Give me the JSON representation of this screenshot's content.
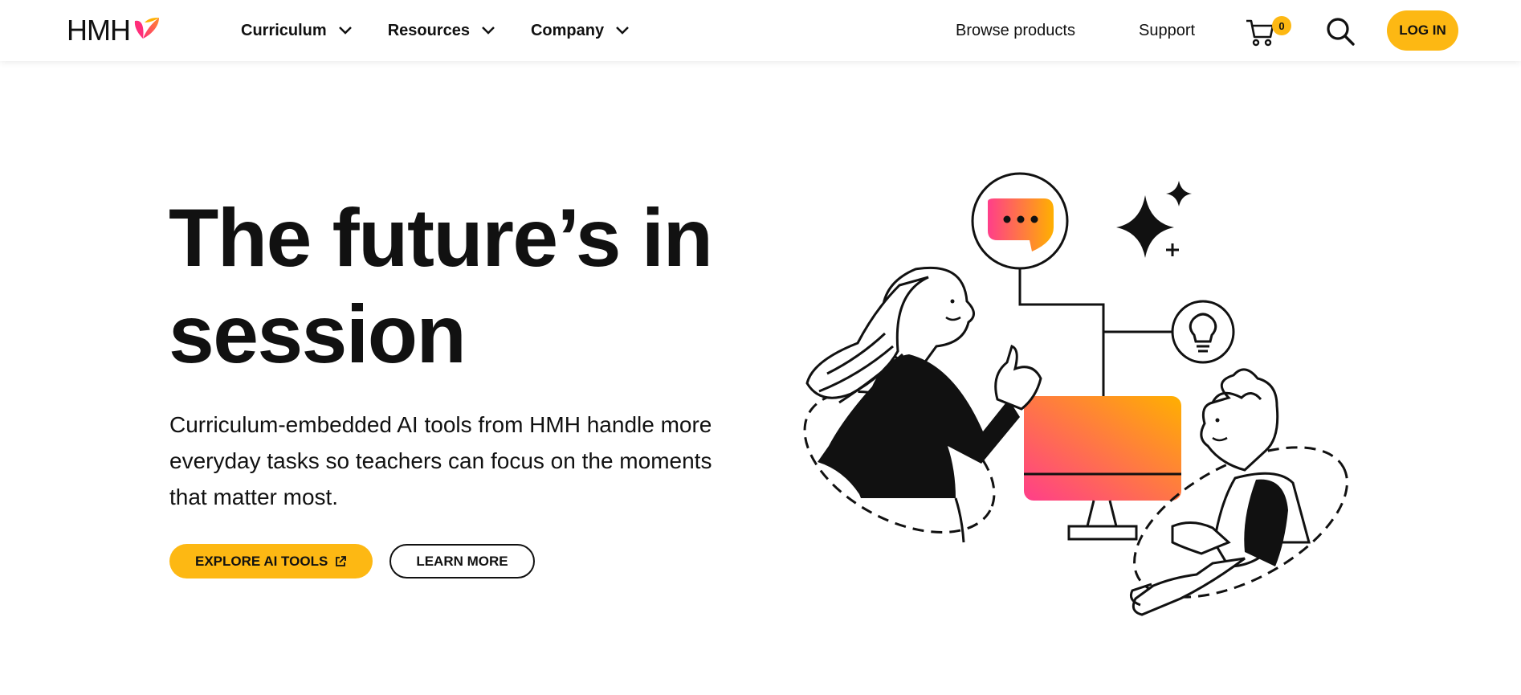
{
  "header": {
    "logo_text": "HMH",
    "nav": [
      {
        "label": "Curriculum"
      },
      {
        "label": "Resources"
      },
      {
        "label": "Company"
      }
    ],
    "browse_label": "Browse products",
    "support_label": "Support",
    "cart_count": "0",
    "login_label": "LOG IN"
  },
  "hero": {
    "title": "The future’s in session",
    "subtitle": "Curriculum-embedded AI tools from HMH handle more everyday tasks so teachers can focus on the moments that matter most.",
    "primary_button": "EXPLORE AI TOOLS",
    "secondary_button": "LEARN MORE"
  },
  "colors": {
    "accent_yellow": "#FDB813",
    "gradient_pink": "#FF3E8A",
    "gradient_orange": "#FFB000",
    "text": "#111111"
  },
  "icons": {
    "cart": "cart-icon",
    "search": "search-icon",
    "chevron": "chevron-down-icon",
    "external": "external-link-icon"
  }
}
